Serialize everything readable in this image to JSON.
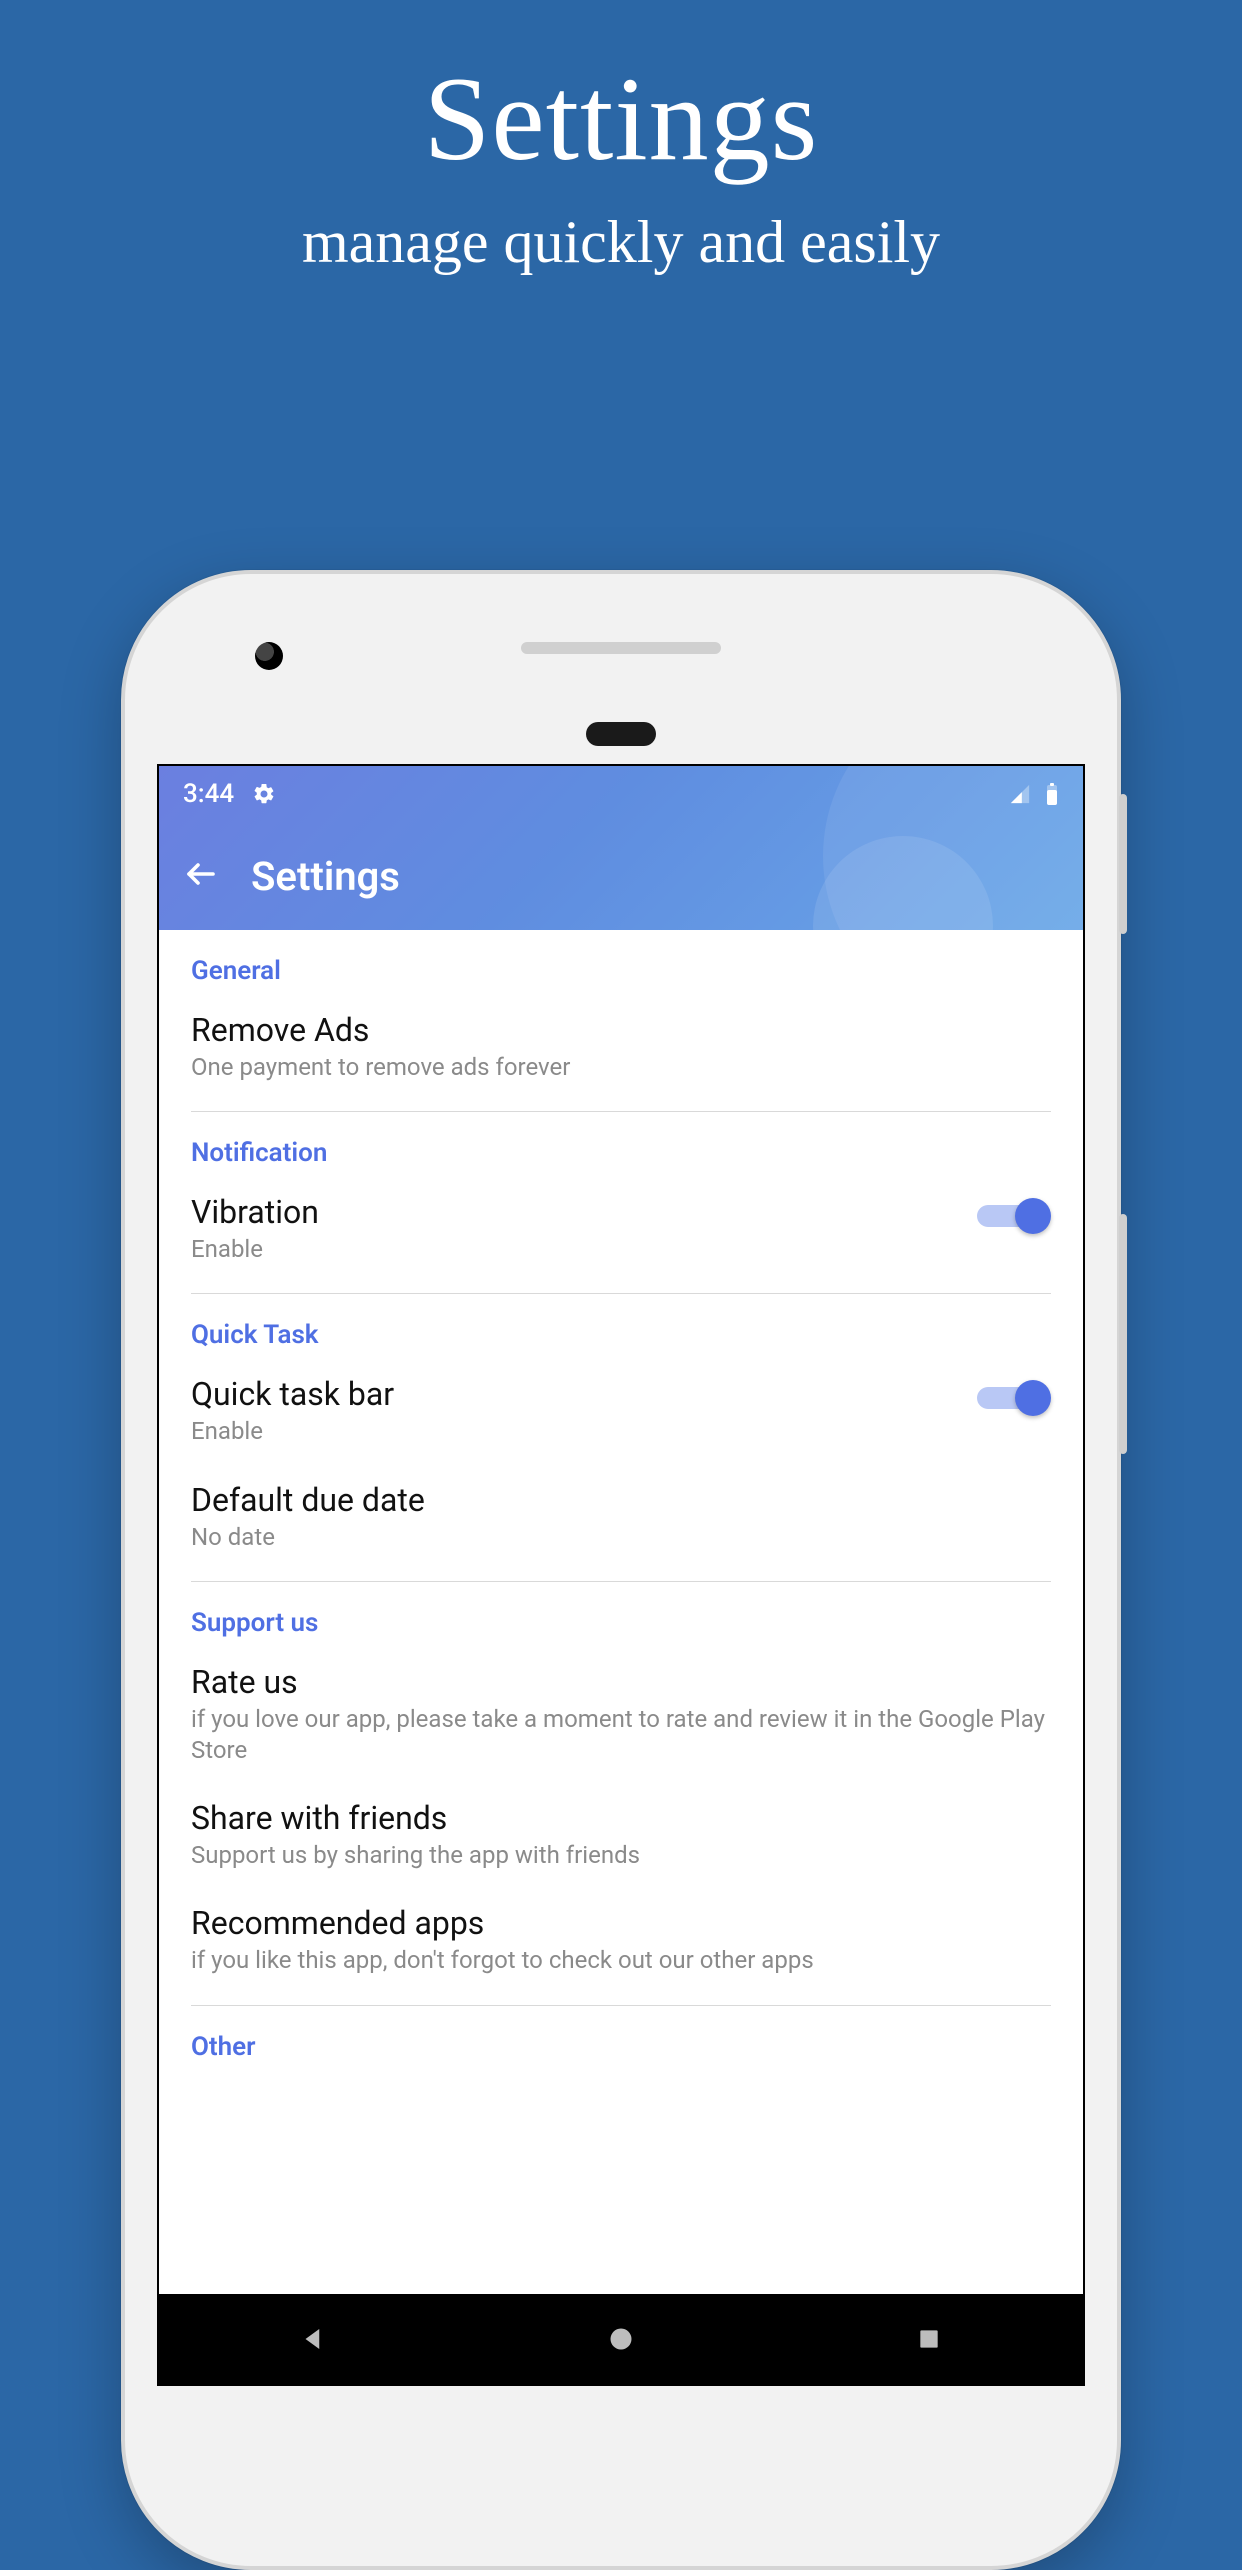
{
  "promo": {
    "title": "Settings",
    "subtitle": "manage quickly and easily"
  },
  "statusbar": {
    "time": "3:44"
  },
  "appbar": {
    "title": "Settings"
  },
  "sections": {
    "general": {
      "label": "General",
      "remove_ads": {
        "title": "Remove Ads",
        "sub": "One payment to remove ads forever"
      }
    },
    "notification": {
      "label": "Notification",
      "vibration": {
        "title": "Vibration",
        "sub": "Enable",
        "on": true
      }
    },
    "quick_task": {
      "label": "Quick Task",
      "quick_task_bar": {
        "title": "Quick task bar",
        "sub": "Enable",
        "on": true
      },
      "default_due_date": {
        "title": "Default due date",
        "sub": "No date"
      }
    },
    "support_us": {
      "label": "Support us",
      "rate_us": {
        "title": "Rate us",
        "sub": "if you love our app, please take a moment to rate and review it in the Google Play Store"
      },
      "share": {
        "title": "Share with friends",
        "sub": "Support us by sharing the app with friends"
      },
      "recommended": {
        "title": "Recommended apps",
        "sub": "if you like this app, don't forgot to check out our other apps"
      }
    },
    "other": {
      "label": "Other"
    }
  },
  "colors": {
    "accent": "#4f6fe3",
    "bg": "#2b67a6"
  }
}
